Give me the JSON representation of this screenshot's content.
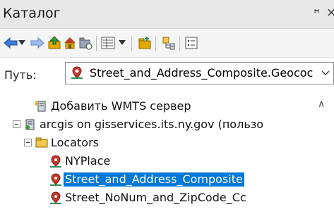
{
  "window": {
    "title": "Каталог",
    "pin_glyph": "ꟸ",
    "close_glyph": "×"
  },
  "toolbar": {
    "buttons": [
      {
        "icon": "back-arrow-icon",
        "color": "#3a7bd5"
      },
      {
        "icon": "dropdown-arrow-icon"
      },
      {
        "icon": "forward-arrow-icon",
        "color": "#3a7bd5"
      },
      {
        "icon": "up-folder-icon",
        "color": "#e0a800"
      },
      {
        "icon": "home-icon",
        "color": "#e0a800"
      },
      {
        "icon": "connect-folder-icon"
      },
      {
        "icon": "view-list-icon"
      },
      {
        "icon": "view-dropdown-icon"
      },
      {
        "icon": "new-folder-icon",
        "color": "#e0a800"
      },
      {
        "icon": "toggle-contents-icon"
      },
      {
        "icon": "options-icon"
      }
    ]
  },
  "path": {
    "label": "Путь:",
    "value": "Street_and_Address_Composite.Geococ"
  },
  "tree": {
    "items": [
      {
        "label": "Добавить WMTS сервер",
        "icon": "add-wmts-server-icon",
        "selected": false
      },
      {
        "label": "arcgis on gisservices.its.ny.gov (пользо",
        "icon": "gis-server-icon",
        "expanded": true,
        "selected": false
      },
      {
        "label": "Locators",
        "icon": "folder-icon",
        "expanded": true,
        "selected": false
      },
      {
        "label": "NYPlace",
        "icon": "locator-icon",
        "selected": false
      },
      {
        "label": "Street_and_Address_Composite",
        "icon": "locator-icon",
        "selected": true
      },
      {
        "label": "Street_NoNum_and_ZipCode_Cc",
        "icon": "locator-icon",
        "selected": false
      }
    ]
  },
  "colors": {
    "selection": "#0078d7",
    "folder": "#f2c94c",
    "locator_red": "#c0392b",
    "locator_green": "#2e8b57"
  }
}
